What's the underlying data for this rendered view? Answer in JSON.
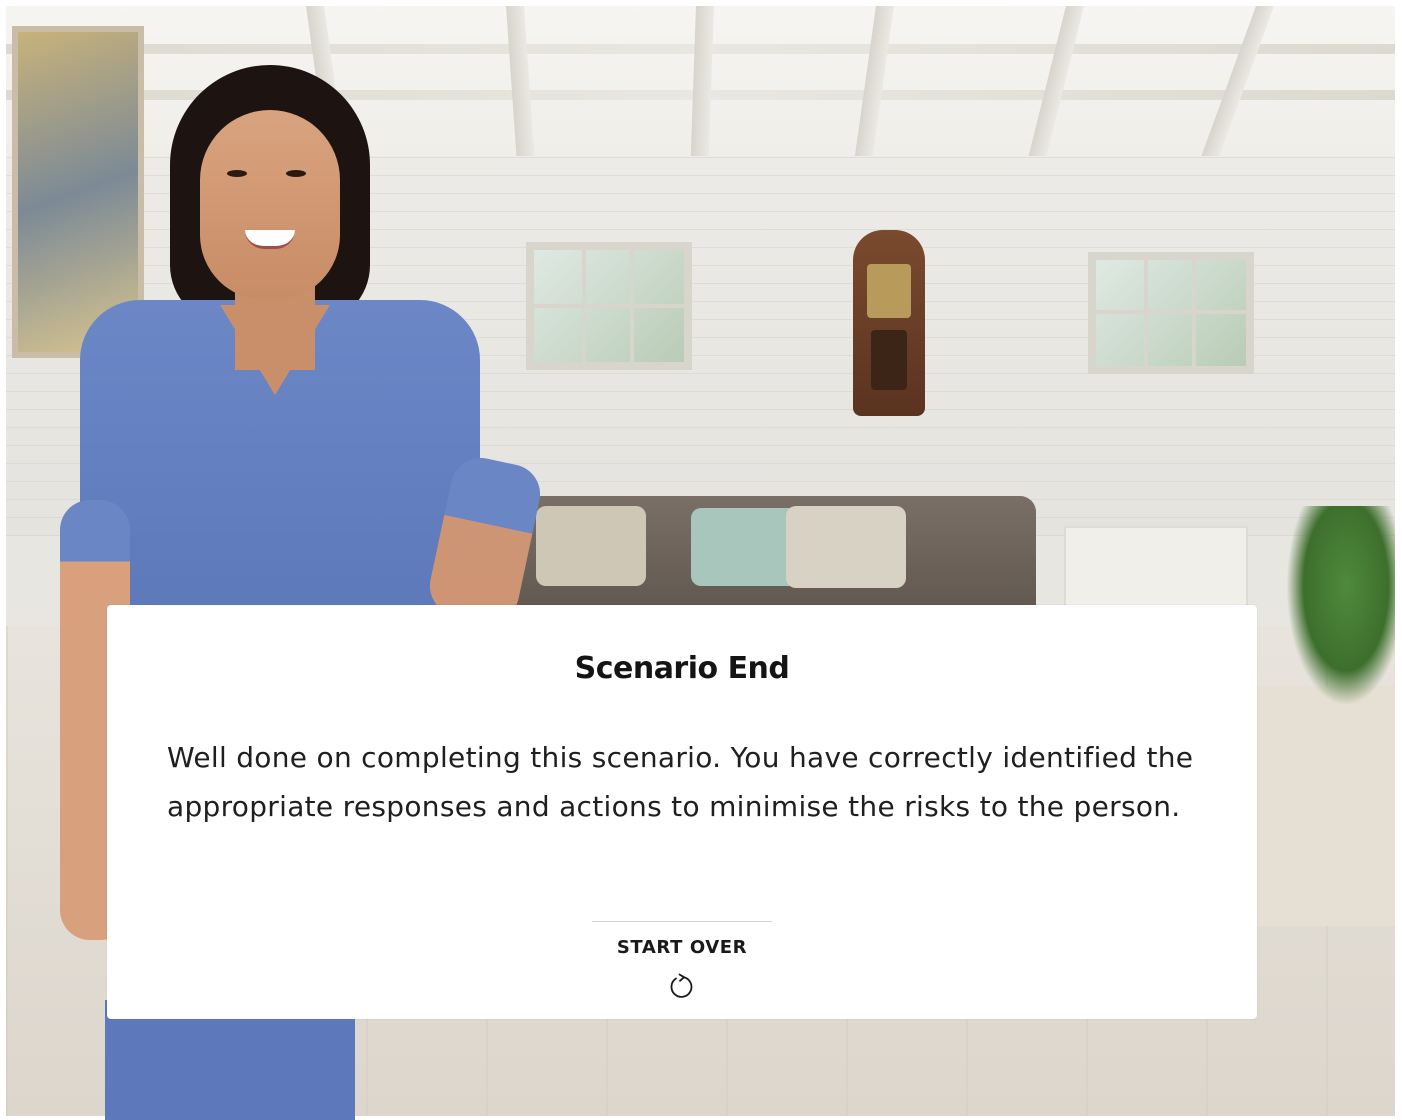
{
  "scene": {
    "background_icon": "living-room-background",
    "character_icon": "nurse-character"
  },
  "card": {
    "title": "Scenario End",
    "body": "Well done on completing this scenario. You have correctly identified the appropriate responses and actions to minimise the risks to the person.",
    "start_over_label": "START OVER",
    "start_over_icon": "restart-icon"
  },
  "colors": {
    "card_bg": "#ffffff",
    "title_text": "#141414",
    "body_text": "#1f1f1f",
    "scrubs": "#6c87c6"
  }
}
